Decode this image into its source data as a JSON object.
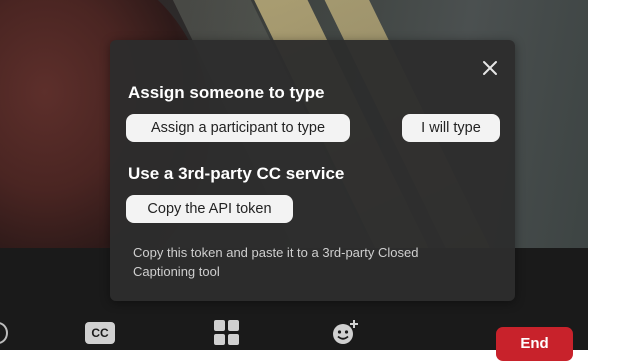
{
  "dialog": {
    "close_icon": "close-icon",
    "section_assign": {
      "heading": "Assign someone to type",
      "assign_participant_label": "Assign a participant to type",
      "i_will_type_label": "I will type"
    },
    "section_third_party": {
      "heading": "Use a 3rd-party CC service",
      "copy_token_label": "Copy the API token",
      "description": "Copy this token and paste it to a 3rd-party Closed Captioning tool"
    }
  },
  "toolbar": {
    "captions_icon": "closed-captions-icon",
    "captions_icon_text": "CC",
    "apps_icon": "apps-grid-icon",
    "reactions_icon": "reactions-emoji-icon",
    "end_label": "End",
    "end_color": "#c8222b"
  }
}
